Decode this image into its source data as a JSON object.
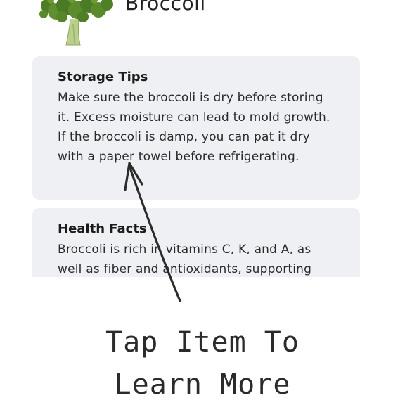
{
  "header": {
    "title": "Broccoli",
    "image_icon": "broccoli-icon"
  },
  "cards": [
    {
      "title": "Storage Tips",
      "body": "Make sure the broccoli is dry before storing it. Excess moisture can lead to mold growth. If the broccoli is damp, you can pat it dry with a paper towel before refrigerating."
    },
    {
      "title": "Health Facts",
      "body": "Broccoli is rich in vitamins C, K, and A, as well as fiber and antioxidants, supporting"
    }
  ],
  "annotation": {
    "line1": "Tap Item To",
    "line2": "Learn More",
    "arrow_icon": "hand-drawn-arrow-icon"
  },
  "colors": {
    "card_background": "#eef0f3",
    "text": "#1f1f1f",
    "annotation": "#2b2b2b",
    "broccoli_green": "#5f8f2e"
  }
}
